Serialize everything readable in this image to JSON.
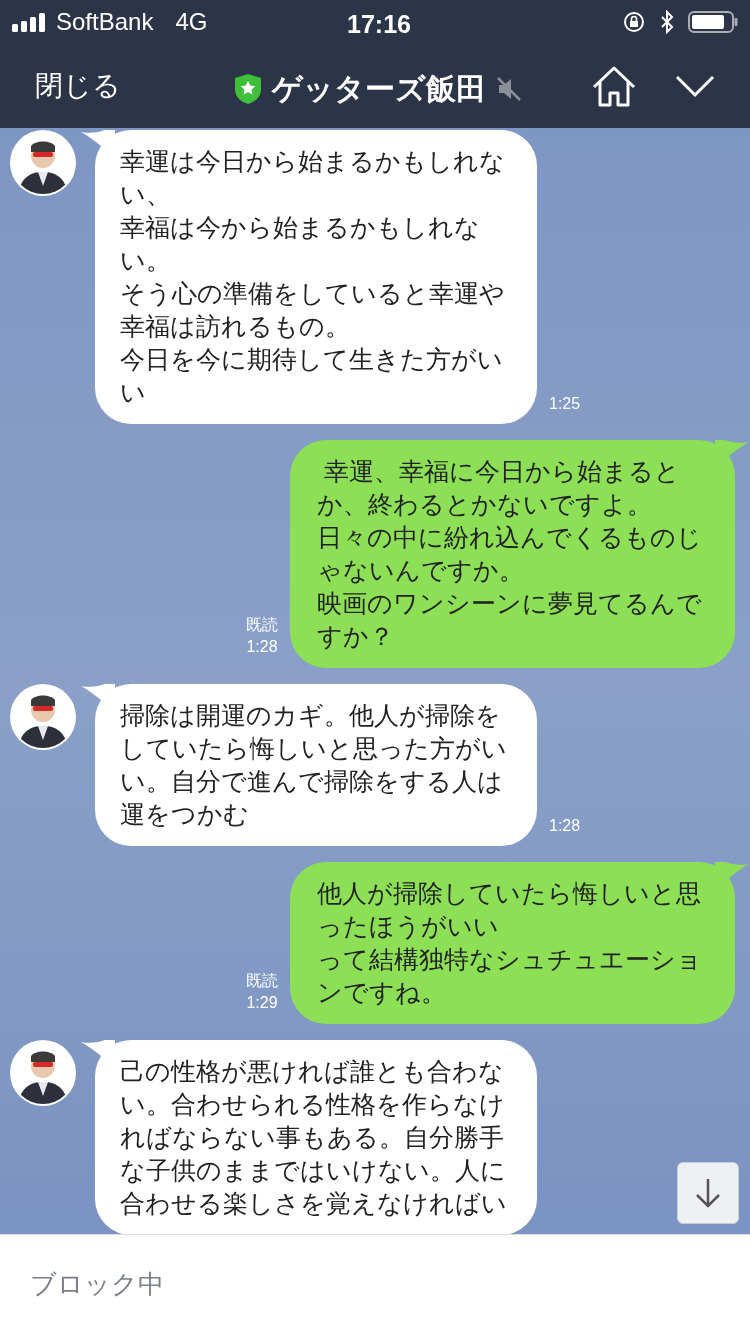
{
  "status_bar": {
    "carrier": "SoftBank",
    "network": "4G",
    "time": "17:16"
  },
  "header": {
    "close": "閉じる",
    "title": "ゲッターズ飯田",
    "muted": true
  },
  "messages": [
    {
      "kind": "incoming",
      "paragraphs": [
        "幸運は今日から始まるかもしれない、",
        "幸福は今から始まるかもしれない。",
        "そう心の準備をしていると幸運や幸福は訪れるもの。",
        "今日を今に期待して生きた方がいい"
      ],
      "time": "1:25"
    },
    {
      "kind": "outgoing",
      "paragraphs": [
        " 幸運、幸福に今日から始まるとか、終わるとかないですよ。",
        "日々の中に紛れ込んでくるものじゃないんですか。",
        "映画のワンシーンに夢見てるんですか？"
      ],
      "read": "既読",
      "time": "1:28"
    },
    {
      "kind": "incoming",
      "paragraphs": [
        "掃除は開運のカギ。他人が掃除をしていたら悔しいと思った方がいい。自分で進んで掃除をする人は運をつかむ"
      ],
      "time": "1:28"
    },
    {
      "kind": "outgoing",
      "paragraphs": [
        "他人が掃除していたら悔しいと思ったほうがいい",
        "って結構独特なシュチュエーションですね。"
      ],
      "read": "既読",
      "time": "1:29"
    },
    {
      "kind": "incoming",
      "paragraphs": [
        "己の性格が悪ければ誰とも合わない。合わせられる性格を作らなければならない事もある。自分勝手な子供のままではいけない。人に合わせる楽しさを覚えなければい"
      ]
    }
  ],
  "footer": {
    "status": "ブロック中"
  }
}
